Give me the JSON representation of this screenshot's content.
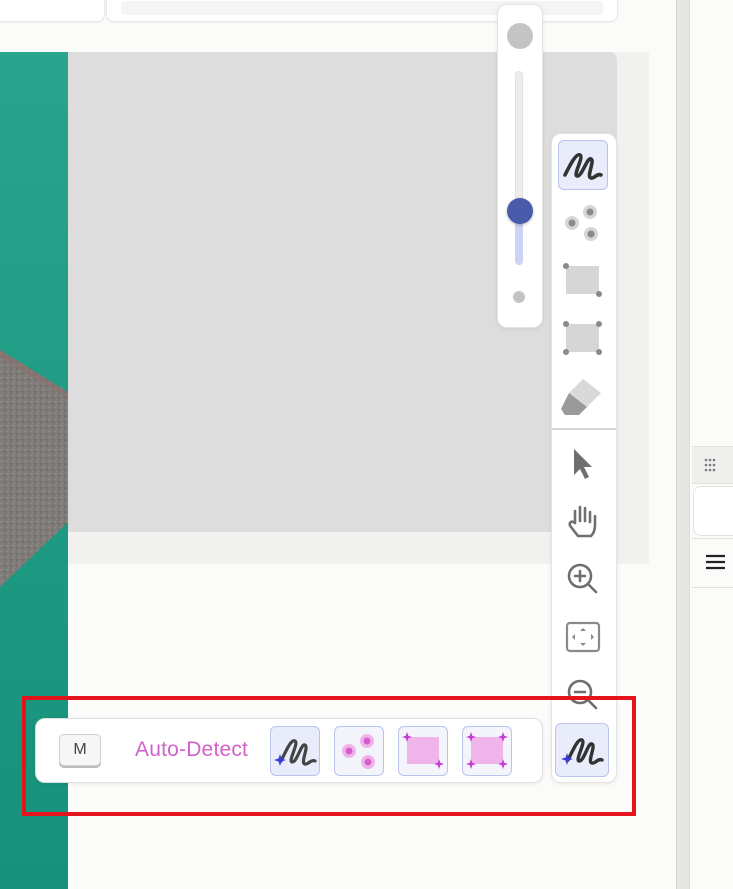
{
  "auto_detect": {
    "key_hint": "M",
    "label": "Auto-Detect",
    "label_color": "#d262c9",
    "tools": [
      {
        "icon": "ai-freehand-icon",
        "selected": true
      },
      {
        "icon": "ai-points-icon",
        "selected": false
      },
      {
        "icon": "ai-box-icon",
        "selected": false
      },
      {
        "icon": "ai-polygon-icon",
        "selected": false
      }
    ]
  },
  "brush_size": {
    "level": 0.28
  },
  "toolbar": {
    "tools": [
      {
        "name": "freehand",
        "icon": "freehand-scribble-icon",
        "active": true
      },
      {
        "name": "points",
        "icon": "points-icon",
        "active": false
      },
      {
        "name": "box",
        "icon": "box-icon",
        "active": false
      },
      {
        "name": "polygon",
        "icon": "polygon-icon",
        "active": false
      },
      {
        "name": "eraser",
        "icon": "eraser-icon",
        "active": false
      },
      {
        "name": "select",
        "icon": "cursor-arrow-icon",
        "active": false
      },
      {
        "name": "pan",
        "icon": "hand-icon",
        "active": false
      },
      {
        "name": "zoom-in",
        "icon": "zoom-in-icon",
        "active": false
      },
      {
        "name": "fit",
        "icon": "fit-screen-icon",
        "active": false
      },
      {
        "name": "zoom-out",
        "icon": "zoom-out-icon",
        "active": false
      }
    ]
  },
  "colors": {
    "accent": "#4a5bab",
    "active_tool_bg": "#e8ecfb",
    "highlight": "#e4141d",
    "image_teal": "#1f9a83"
  }
}
